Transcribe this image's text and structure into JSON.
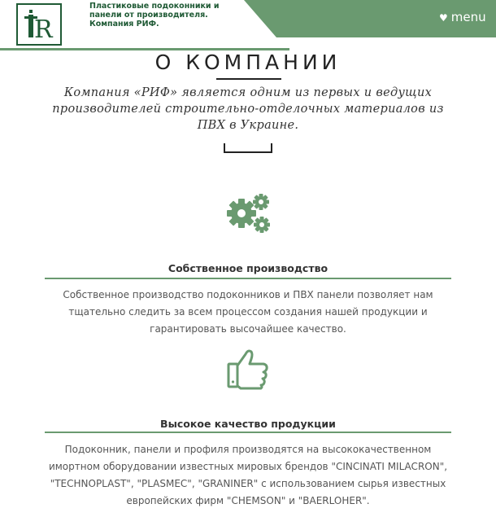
{
  "header": {
    "logo_text": "R",
    "tagline": "Пластиковые подоконники и панели от производителя. Компания РИФ.",
    "menu_label": "menu",
    "menu_icon": "heart-icon"
  },
  "colors": {
    "brand_green": "#6a9a70",
    "dark_green": "#1f5a35",
    "text": "#333333"
  },
  "main": {
    "title": "О КОМПАНИИ",
    "intro": "Компания «РИФ» является одним из первых и ведущих производителей строительно-отделочных материалов из ПВХ в Украине."
  },
  "features": [
    {
      "icon": "gears-icon",
      "title": "Собственное производство",
      "text": "Собственное производство подоконников и ПВХ панели позволяет нам тщательно следить за всем процессом создания нашей продукции и гарантировать высочайшее качество."
    },
    {
      "icon": "thumbs-up-icon",
      "title": "Высокое качество продукции",
      "text": "Подоконник, панели и профиля производятся на высококачественном имортном оборудовании известных мировых брендов \"CINCINATI MILACRON\", \"TECHNOPLAST\", \"PLASMEC\", \"GRANINER\" с использованием сырья известных европейских фирм \"CHEMSON\" и \"BAERLOHER\"."
    }
  ]
}
